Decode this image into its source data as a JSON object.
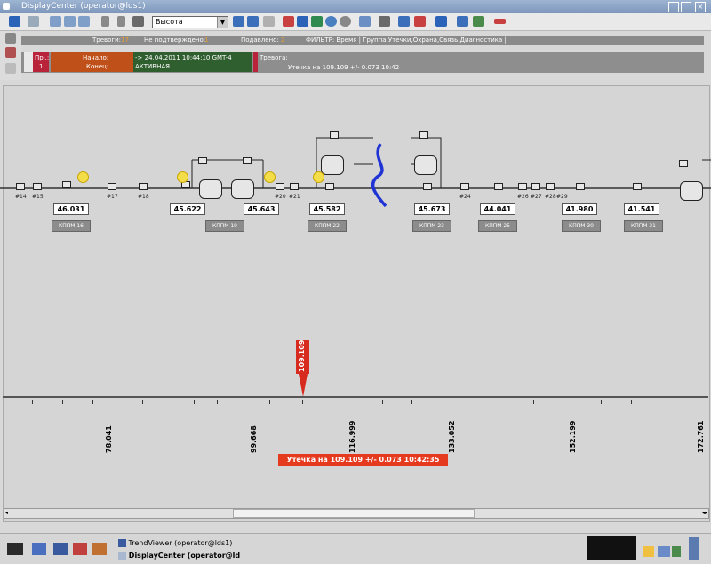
{
  "window": {
    "title": "DisplayCenter (operator@lds1)"
  },
  "toolbar": {
    "select_value": "Высота"
  },
  "alarms": {
    "trevogi_label": "Тревоги:",
    "trevogi_count": "17",
    "nepodtv_label": "Не подтверждено:",
    "nepodtv_count": "1",
    "podavleno_label": "Подавлено:",
    "podavleno_count": "2",
    "filter_text": "ФИЛЬТР: Время | Группа:Утечки,Охрана,Связь,Диагностика |"
  },
  "alarm_row": {
    "pri_label": "Прi.:",
    "pri_value": "1",
    "start_label": "Начало:",
    "end_label": "Конец:",
    "start_value": "-> 24.04.2011 10:44:10 GMT-4",
    "status_value": "АКТИВНАЯ",
    "type_label": "Тревога:",
    "message": "Утечка на 109.109 +/- 0.073 10:42"
  },
  "mimic": {
    "nodes": [
      "#14",
      "#15",
      "#17",
      "#18",
      "#20",
      "#21",
      "#24",
      "#26",
      "#27",
      "#28",
      "#29"
    ],
    "values": [
      "46.031",
      "45.622",
      "45.643",
      "45.582",
      "45.673",
      "44.041",
      "41.980",
      "41.541"
    ],
    "stations": [
      "КППМ 16",
      "КППМ 19",
      "КППМ 22",
      "КППМ 23",
      "КППМ 25",
      "КППМ 30",
      "КППМ 31"
    ]
  },
  "scale": {
    "marks": [
      "78.041",
      "99.668",
      "116.999",
      "133.052",
      "152.199",
      "172.761"
    ]
  },
  "leak": {
    "marker_value": "109.109",
    "banner": "Утечка на 109.109 +/- 0.073 10:42:35"
  },
  "taskbar": {
    "task1": "TrendViewer (operator@lds1)",
    "task2": "DisplayCenter (operator@ld"
  }
}
